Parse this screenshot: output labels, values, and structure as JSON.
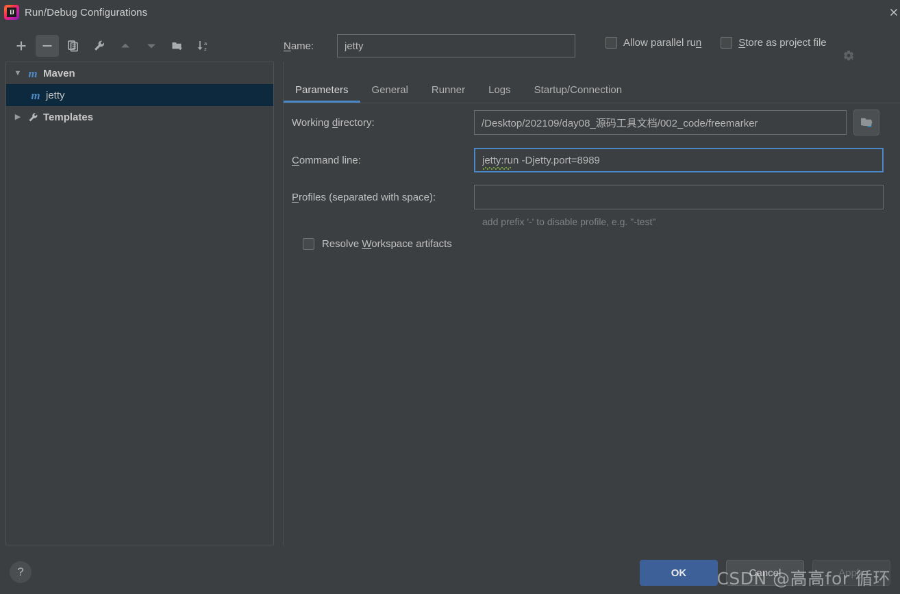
{
  "window": {
    "title": "Run/Debug Configurations",
    "logo_icon": "intellij-idea-logo",
    "close_icon": "close-icon"
  },
  "toolbar": {
    "buttons": [
      {
        "name": "add-configuration-button",
        "icon": "plus-icon",
        "label": "+"
      },
      {
        "name": "remove-configuration-button",
        "icon": "minus-icon",
        "label": "−"
      },
      {
        "name": "copy-configuration-button",
        "icon": "copy-icon",
        "label": "Copy"
      },
      {
        "name": "edit-templates-button",
        "icon": "wrench-icon",
        "label": "Edit Templates"
      },
      {
        "name": "move-up-button",
        "icon": "arrow-up-icon",
        "label": "Move Up"
      },
      {
        "name": "move-down-button",
        "icon": "arrow-down-icon",
        "label": "Move Down"
      },
      {
        "name": "new-folder-button",
        "icon": "folder-plus-icon",
        "label": "New Folder"
      },
      {
        "name": "sort-configurations-button",
        "icon": "sort-az-icon",
        "label": "Sort Alphabetically"
      }
    ]
  },
  "tree": {
    "nodes": [
      {
        "label": "Maven",
        "icon": "maven-m-icon",
        "twisty": "▼",
        "level": 0,
        "selected": false
      },
      {
        "label": "jetty",
        "icon": "maven-m-icon",
        "twisty": "",
        "level": 1,
        "selected": true
      },
      {
        "label": "Templates",
        "icon": "wrench-icon",
        "twisty": "▶",
        "level": 0,
        "selected": false
      }
    ]
  },
  "header": {
    "name_label_prefix": "N",
    "name_label_rest": "ame:",
    "name_value": "jetty",
    "name_placeholder": "",
    "allow_parallel_run": {
      "text_before": "Allow parallel ru",
      "mnemonic": "n",
      "text_after": "",
      "checked": false
    },
    "store_as_project_file": {
      "mnemonic": "S",
      "text_after": "tore as project file",
      "checked": false
    },
    "gear_icon": "gear-dropdown-icon"
  },
  "tabs": [
    {
      "label": "Parameters",
      "active": true
    },
    {
      "label": "General",
      "active": false
    },
    {
      "label": "Runner",
      "active": false
    },
    {
      "label": "Logs",
      "active": false
    },
    {
      "label": "Startup/Connection",
      "active": false
    }
  ],
  "form": {
    "working_directory": {
      "label_before": "Working ",
      "mnemonic": "d",
      "label_after": "irectory:",
      "value": "/Desktop/202109/day08_源码工具文档/002_code/freemarker",
      "placeholder": "",
      "inline_icon": "folder-open-icon",
      "side_button_icon": "module-folder-icon"
    },
    "command_line": {
      "mnemonic": "C",
      "label_after": "ommand line:",
      "value": "jetty:run -Djetty.port=8989",
      "placeholder": "",
      "focused": true,
      "spellcheck_word": "jetty"
    },
    "profiles": {
      "mnemonic": "P",
      "label_after": "rofiles (separated with space):",
      "value": "",
      "placeholder": "",
      "hint": "add prefix '-' to disable profile, e.g. \"-test\""
    },
    "resolve_workspace_artifacts": {
      "text_before": "Resolve ",
      "mnemonic": "W",
      "text_after": "orkspace artifacts",
      "checked": false
    }
  },
  "footer": {
    "help_label": "?",
    "ok_label": "OK",
    "cancel_label": "Cancel",
    "apply_label": "Apply",
    "apply_enabled": false
  },
  "watermark": "CSDN @高高for 循环",
  "colors": {
    "background": "#3c3f41",
    "accent_blue": "#4a88c7",
    "selection": "#0d293e",
    "primary_button": "#3c6097",
    "maven_icon": "#4e89c3",
    "spellcheck_green": "#7aa83c"
  }
}
